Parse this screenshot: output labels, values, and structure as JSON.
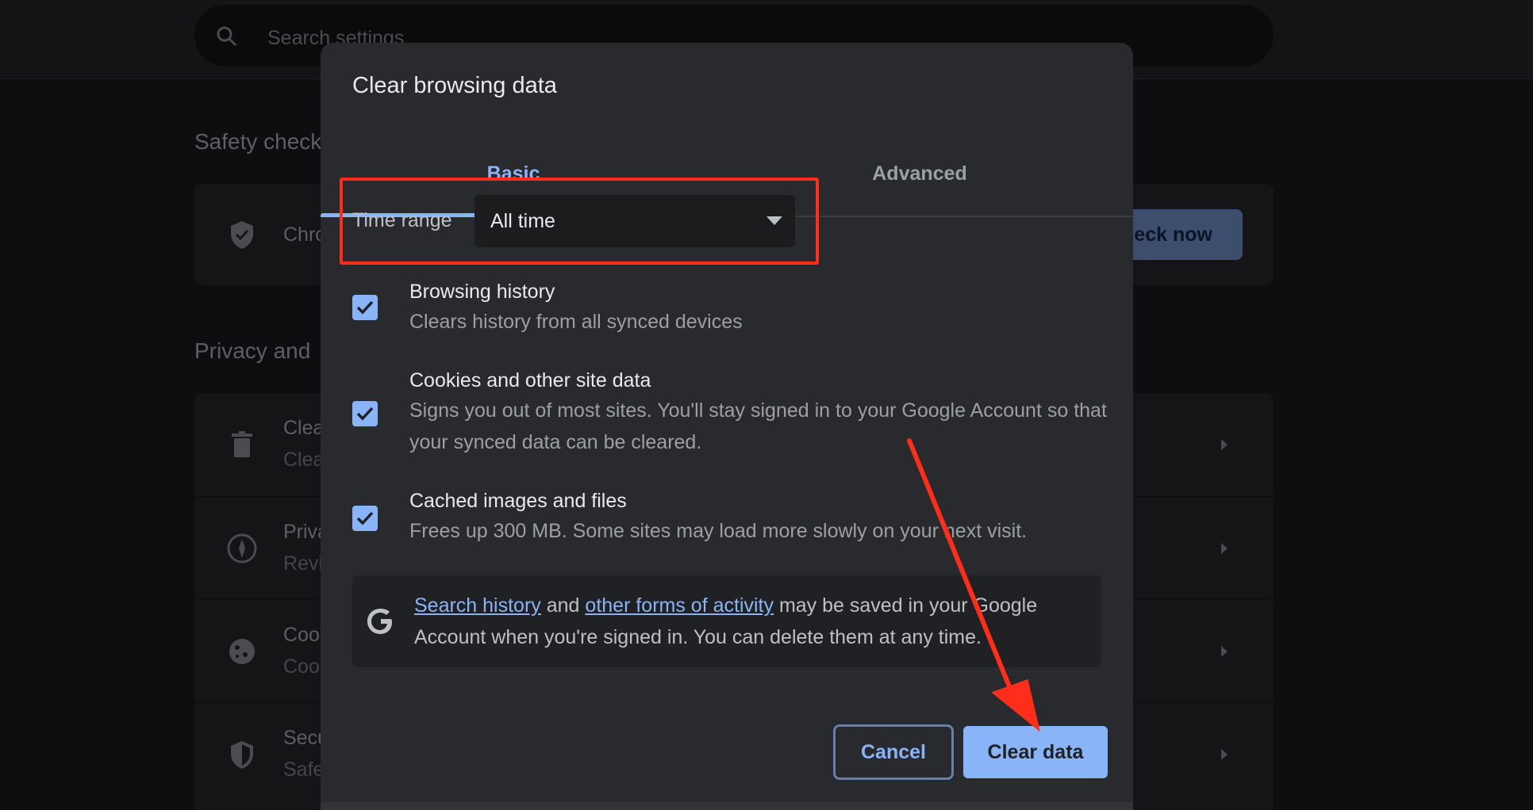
{
  "background": {
    "search": {
      "placeholder": "Search settings"
    },
    "safety_check": {
      "section_title": "Safety check",
      "row_title": "Chro",
      "button_label": "heck now"
    },
    "privacy": {
      "section_title": "Privacy and",
      "rows": [
        {
          "icon": "trash-icon",
          "title": "Clea",
          "subtitle": "Clea"
        },
        {
          "icon": "compass-icon",
          "title": "Priva",
          "subtitle": "Revi"
        },
        {
          "icon": "cookie-icon",
          "title": "Coo",
          "subtitle": "Coo"
        },
        {
          "icon": "shield-icon",
          "title": "Secu",
          "subtitle": "Safe"
        }
      ]
    }
  },
  "dialog": {
    "title": "Clear browsing data",
    "tabs": [
      {
        "label": "Basic",
        "active": true
      },
      {
        "label": "Advanced",
        "active": false
      }
    ],
    "time_range": {
      "label": "Time range",
      "value": "All time"
    },
    "options": [
      {
        "title": "Browsing history",
        "description": "Clears history from all synced devices",
        "checked": true
      },
      {
        "title": "Cookies and other site data",
        "description": "Signs you out of most sites. You'll stay signed in to your Google Account so that your synced data can be cleared.",
        "checked": true
      },
      {
        "title": "Cached images and files",
        "description": "Frees up 300 MB. Some sites may load more slowly on your next visit.",
        "checked": true
      }
    ],
    "info": {
      "link1": "Search history",
      "connector": "and",
      "link2": "other forms of activity",
      "text": "may be saved in your Google Account when you're signed in. You can delete them at any time."
    },
    "buttons": {
      "cancel": "Cancel",
      "clear": "Clear data"
    }
  },
  "colors": {
    "accent": "#8ab4f8",
    "dialog_bg": "#292a2d",
    "annotation": "#ff2d1a"
  }
}
